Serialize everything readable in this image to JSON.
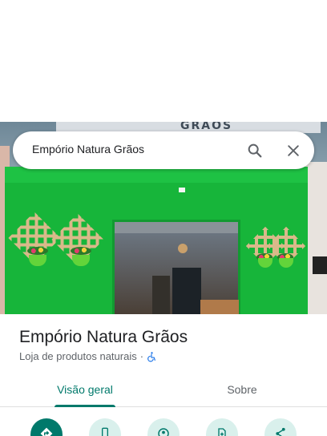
{
  "search": {
    "query": "Empório Natura Grãos",
    "search_icon": "search-icon",
    "close_icon": "close-icon"
  },
  "photo": {
    "sign_text": "GRAOS",
    "description_icon": "storefront-photo"
  },
  "place": {
    "name": "Empório Natura Grãos",
    "category": "Loja de produtos naturais",
    "separator": "·",
    "accessibility_icon": "wheelchair-icon"
  },
  "tabs": [
    {
      "label": "Visão geral",
      "selected": true
    },
    {
      "label": "Sobre",
      "selected": false
    }
  ],
  "actions": [
    {
      "icon": "directions-icon",
      "style": "primary"
    },
    {
      "icon": "phone-icon",
      "style": "secondary"
    },
    {
      "icon": "location-icon",
      "style": "secondary"
    },
    {
      "icon": "save-icon",
      "style": "secondary"
    },
    {
      "icon": "share-icon",
      "style": "secondary"
    }
  ],
  "colors": {
    "accent": "#00796b",
    "accent_light": "#d9f0ec",
    "text_primary": "#202124",
    "text_secondary": "#5f6368",
    "accessibility_blue": "#1a73e8"
  }
}
